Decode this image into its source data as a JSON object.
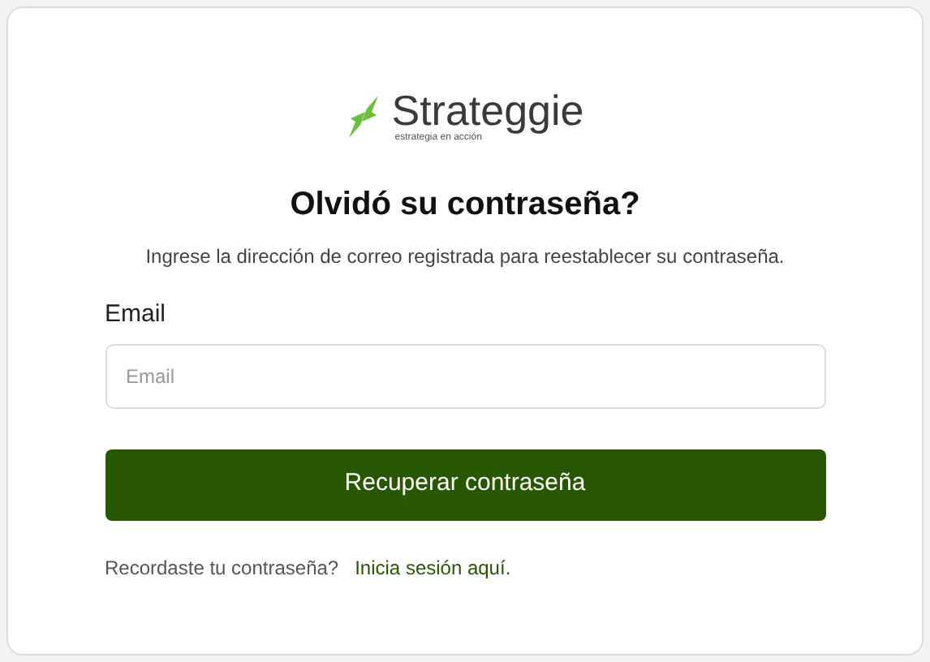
{
  "logo": {
    "name": "Strateggie",
    "tagline": "estrategia en acción"
  },
  "title": "Olvidó su contraseña?",
  "subtitle": "Ingrese la dirección de correo registrada para reestablecer su contraseña.",
  "email": {
    "label": "Email",
    "placeholder": "Email"
  },
  "submit": "Recuperar contraseña",
  "footer": {
    "text": "Recordaste tu contraseña?",
    "link": "Inicia sesión aquí."
  }
}
